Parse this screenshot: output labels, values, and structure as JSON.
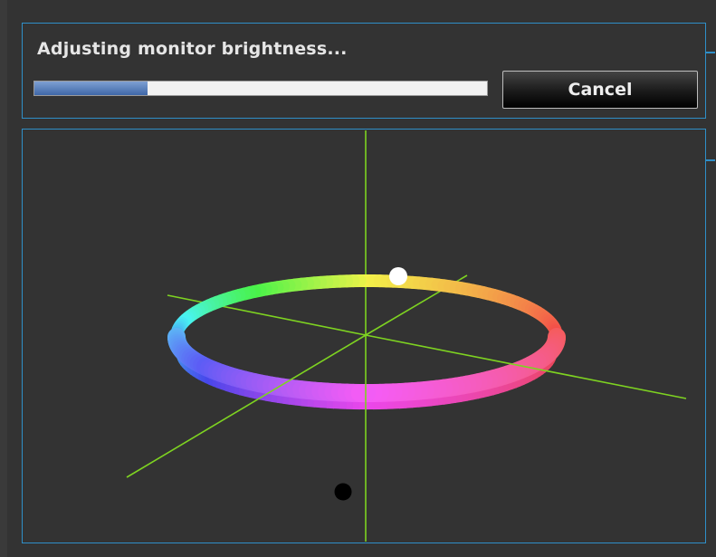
{
  "status": {
    "message": "Adjusting monitor brightness...",
    "progress": 0.25
  },
  "actions": {
    "cancel_label": "Cancel"
  },
  "colors": {
    "panel_border": "#2f8fc8",
    "axis": "#7ed321",
    "background": "#333333",
    "progress_fill": "#5277b8"
  },
  "icons": {
    "white_marker": "white-point-icon",
    "black_marker": "black-point-icon"
  }
}
